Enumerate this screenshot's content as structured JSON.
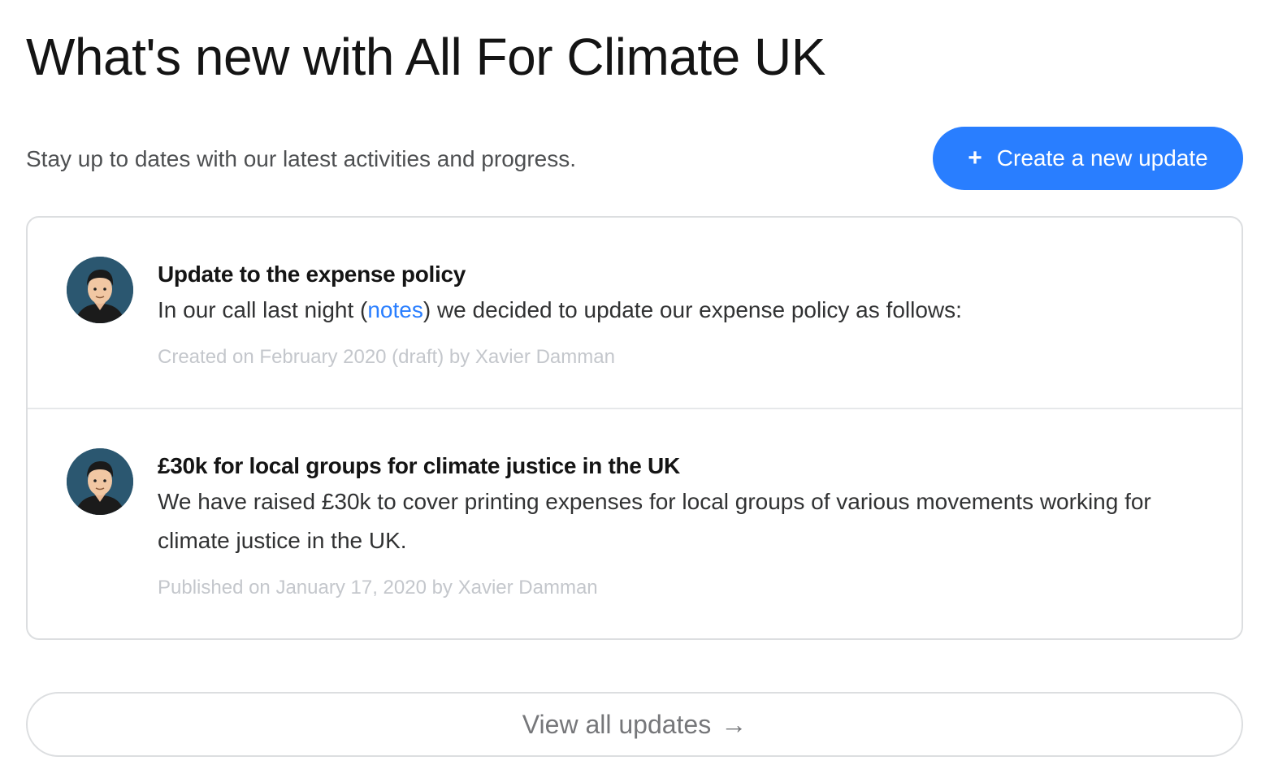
{
  "header": {
    "title": "What's new with All For Climate UK",
    "subtitle": "Stay up to dates with our latest activities and progress.",
    "create_button": {
      "icon": "plus-icon",
      "icon_glyph": "+",
      "label": "Create a new update"
    }
  },
  "updates": [
    {
      "title": "Update to the expense policy",
      "summary_before": "In our call last night (",
      "summary_link": "notes",
      "summary_after": ") we decided to update our expense policy as follows:",
      "meta": "Created on February 2020 (draft) by Xavier Damman"
    },
    {
      "title": "£30k for local groups for climate justice in the UK",
      "summary": "We have raised £30k to cover printing expenses for local groups of various movements working for climate justice in the UK.",
      "meta": "Published on January 17, 2020 by Xavier Damman"
    }
  ],
  "footer": {
    "view_all_label": "View all updates",
    "view_all_arrow": "→"
  },
  "colors": {
    "accent": "#297eff",
    "muted_text": "#c4c7cc",
    "border": "#dcdee0"
  }
}
